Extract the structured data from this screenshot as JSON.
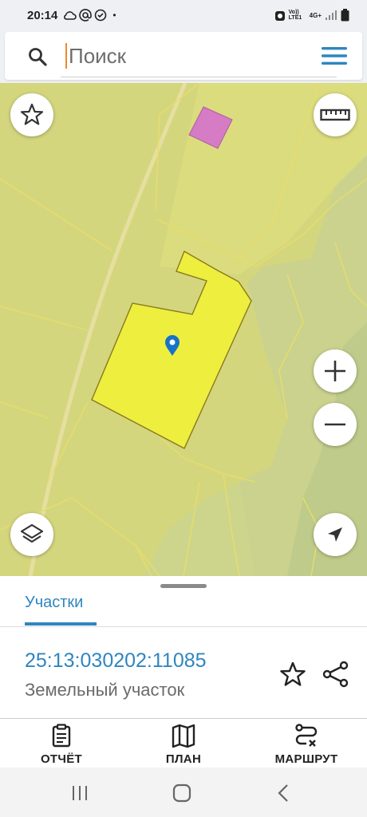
{
  "status_bar": {
    "time": "20:14",
    "dot": "•",
    "network_label": "Vo)) LTE1",
    "data_label": "4G+"
  },
  "search": {
    "placeholder": "Поиск",
    "value": ""
  },
  "map": {
    "colors": {
      "base": "#d3d47c",
      "parcel_highlight": "#eeee3e",
      "parcel_outline": "#8a7a1e",
      "pink_parcel": "#d57cc4",
      "grey_area": "#c6cf94"
    },
    "pin_color": "#1673c8"
  },
  "sheet": {
    "tab_label": "Участки",
    "cadastral_number": "25:13:030202:11085",
    "parcel_type": "Земельный участок"
  },
  "bottom_nav": {
    "items": [
      {
        "label": "ОТЧЁТ",
        "icon": "report-icon"
      },
      {
        "label": "ПЛАН",
        "icon": "map-plan-icon"
      },
      {
        "label": "МАРШРУТ",
        "icon": "route-icon"
      }
    ]
  },
  "accent_color": "#2f86c0"
}
